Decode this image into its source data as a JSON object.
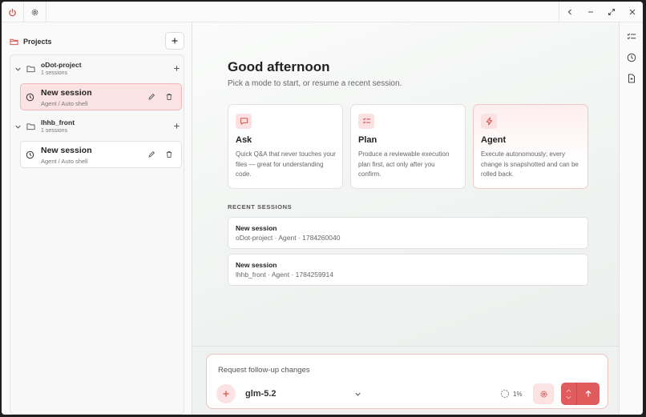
{
  "sidebar": {
    "title": "Projects",
    "projects": [
      {
        "name": "oDot-project",
        "count": "1 sessions",
        "session": {
          "name": "New session",
          "sub": "Agent / Auto shell",
          "active": true
        }
      },
      {
        "name": "lhhb_front",
        "count": "1 sessions",
        "session": {
          "name": "New session",
          "sub": "Agent / Auto shell",
          "active": false
        }
      }
    ]
  },
  "main": {
    "greeting": "Good afternoon",
    "subtitle": "Pick a mode to start, or resume a recent session.",
    "modes": [
      {
        "title": "Ask",
        "icon": "chat-bubble-icon",
        "desc": "Quick Q&A that never touches your files — great for understanding code."
      },
      {
        "title": "Plan",
        "icon": "checklist-icon",
        "desc": "Produce a reviewable execution plan first, act only after you confirm."
      },
      {
        "title": "Agent",
        "icon": "lightning-icon",
        "desc": "Execute autonomously; every change is snapshotted and can be rolled back.",
        "selected": true
      }
    ],
    "recent_label": "RECENT SESSIONS",
    "recent": [
      {
        "name": "New session",
        "meta": "oDot-project · Agent · 1784260040"
      },
      {
        "name": "New session",
        "meta": "lhhb_front · Agent · 1784259914"
      }
    ]
  },
  "composer": {
    "placeholder": "Request follow-up changes",
    "model": "glm-5.2",
    "context_pct": "1%"
  },
  "colors": {
    "accent": "#e05b5b",
    "accent_soft": "#fbe3e3",
    "icon_red": "#d9534f"
  }
}
